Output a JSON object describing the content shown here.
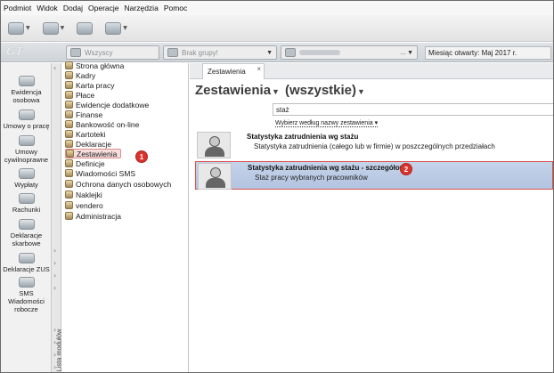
{
  "menubar": {
    "items": [
      "Podmiot",
      "Widok",
      "Dodaj",
      "Operacje",
      "Narzędzia",
      "Pomoc"
    ]
  },
  "filterbar": {
    "logo": "GT",
    "company_combo": "Wszyscy",
    "group_combo": "Brak grupy!",
    "open_month": "Miesiąc otwarty: Maj 2017 r."
  },
  "modules": [
    {
      "label": "Ewidencja osobowa",
      "icon": "people-icon"
    },
    {
      "label": "Umowy o pracę",
      "icon": "contract-icon"
    },
    {
      "label": "Umowy cywilnoprawne",
      "icon": "civil-contract-icon"
    },
    {
      "label": "Wypłaty",
      "icon": "payout-icon"
    },
    {
      "label": "Rachunki",
      "icon": "bills-icon"
    },
    {
      "label": "Deklaracje skarbowe",
      "icon": "tax-declaration-icon"
    },
    {
      "label": "Deklaracje ZUS",
      "icon": "zus-icon"
    },
    {
      "label": "SMS Wiadomości robocze",
      "icon": "sms-icon"
    }
  ],
  "strip_label": "Lista modułów",
  "nav": {
    "items": [
      "Strona główna",
      "Kadry",
      "Karta pracy",
      "Płace",
      "Ewidencje dodatkowe",
      "Finanse",
      "Bankowość on-line",
      "Kartoteki",
      "Deklaracje",
      "Zestawienia",
      "Definicje",
      "Wiadomości SMS",
      "Ochrona danych osobowych",
      "Naklejki",
      "vendero",
      "Administracja"
    ],
    "selected_index": 9
  },
  "markers": {
    "one": "1",
    "two": "2"
  },
  "main": {
    "tab_label": "Zestawienia",
    "tab_close": "×",
    "heading": "Zestawienia",
    "heading_filter": "(wszystkie)",
    "search_value": "staż",
    "sort_label": "Wybierz według nazwy zestawienia ▾",
    "results": [
      {
        "title": "Statystyka zatrudnienia wg stażu",
        "description": "Statystyka zatrudnienia (całego lub w firmie) w poszczególnych przedziałach"
      },
      {
        "title": "Statystyka zatrudnienia wg stażu - szczegółowa",
        "description": "Staż pracy wybranych pracowników"
      }
    ]
  }
}
